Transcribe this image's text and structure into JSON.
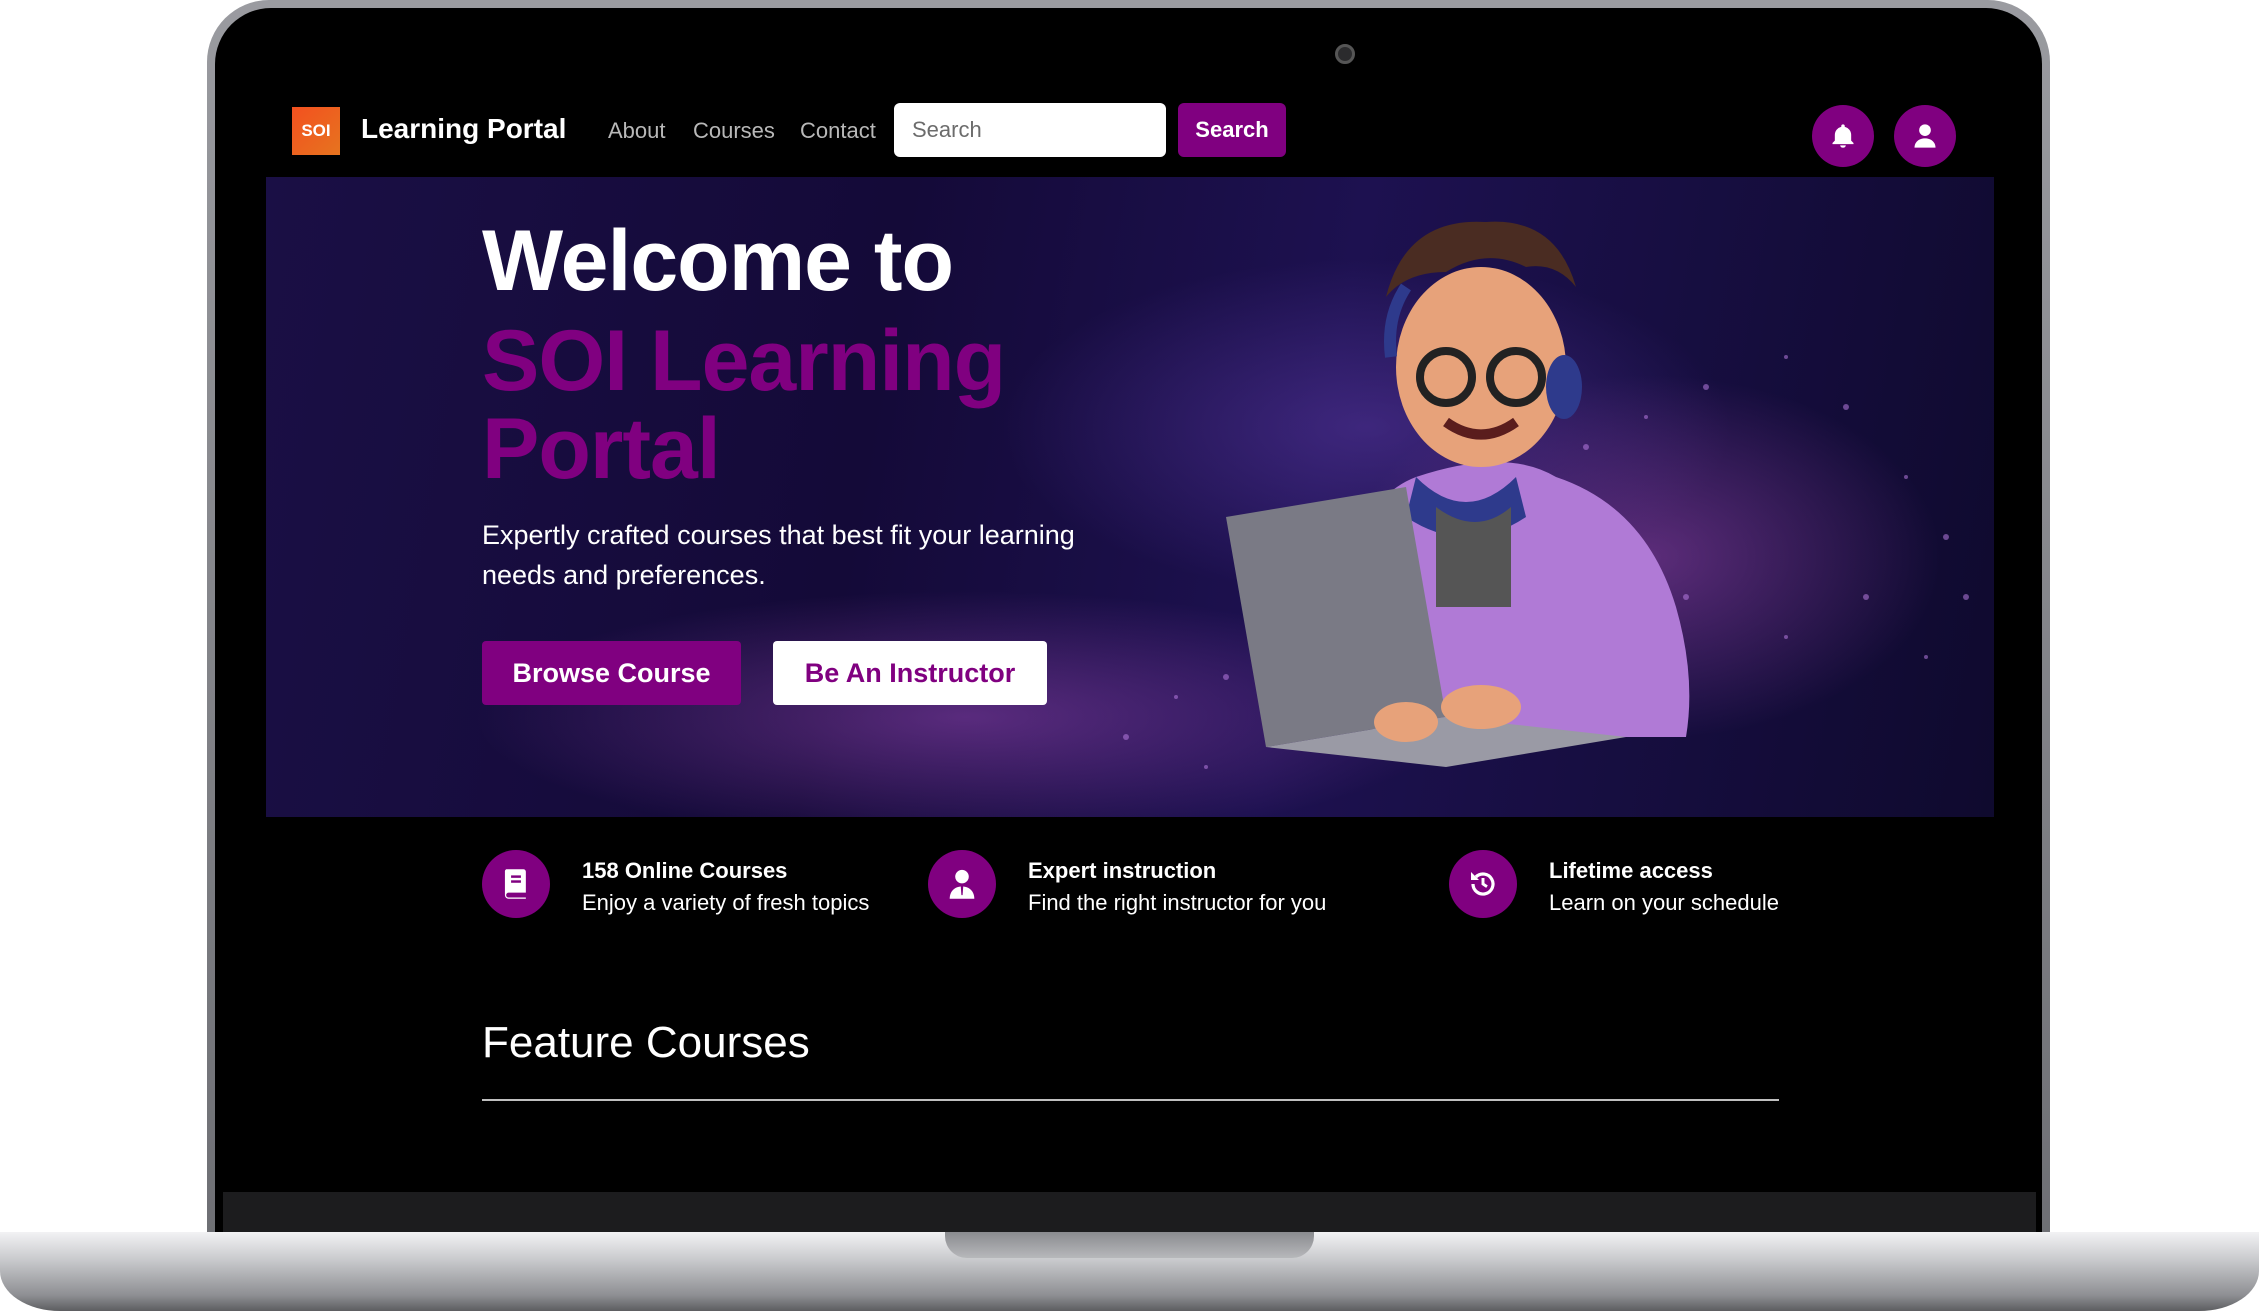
{
  "header": {
    "logo_text": "SOI",
    "brand": "Learning Portal",
    "nav": [
      "About",
      "Courses",
      "Contact"
    ],
    "search_placeholder": "Search",
    "search_button": "Search"
  },
  "hero": {
    "title_line1": "Welcome to",
    "title_line2": "SOI Learning Portal",
    "subtitle": "Expertly crafted courses that best fit your learning needs and preferences.",
    "primary_button": "Browse Course",
    "secondary_button": "Be An Instructor"
  },
  "features": [
    {
      "icon": "book-icon",
      "title": "158 Online Courses",
      "desc": "Enjoy a variety of fresh topics"
    },
    {
      "icon": "instructor-icon",
      "title": "Expert instruction",
      "desc": "Find the right instructor for you"
    },
    {
      "icon": "history-icon",
      "title": "Lifetime access",
      "desc": "Learn on your schedule"
    }
  ],
  "section": {
    "title": "Feature Courses"
  },
  "colors": {
    "accent": "#800080",
    "background": "#000000",
    "hero_dark": "#140a38"
  }
}
